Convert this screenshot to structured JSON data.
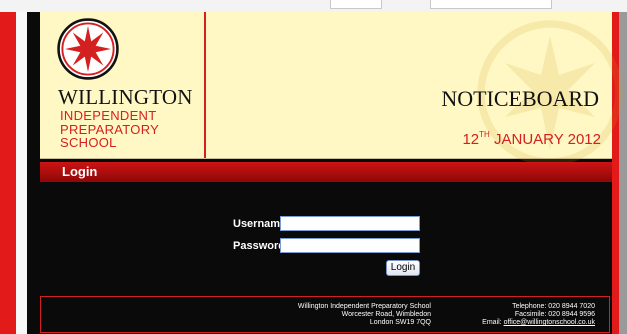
{
  "header": {
    "school_name": "WILLINGTON",
    "school_sub_line1": "INDEPENDENT",
    "school_sub_line2": "PREPARATORY",
    "school_sub_line3": "SCHOOL",
    "page_title": "NOTICEBOARD",
    "date_day": "12",
    "date_suffix": "TH",
    "date_rest": " JANUARY 2012"
  },
  "login": {
    "title": "Login",
    "username_label": "Username:",
    "password_label": "Password:",
    "username_value": "",
    "password_value": "",
    "button_label": "Login"
  },
  "footer": {
    "address_line1": "Willington Independent Preparatory School",
    "address_line2": "Worcester Road, Wimbledon",
    "address_line3": "London SW19 7QQ",
    "telephone": "Telephone: 020 8944 7020",
    "facsimile": "Facsimile: 020 8944 9596",
    "email_label": "Email: ",
    "email": "office@willingtonschool.co.uk"
  },
  "colors": {
    "accent_red": "#d42020",
    "cream": "#fff8c4",
    "background": "#0a0a0a"
  }
}
